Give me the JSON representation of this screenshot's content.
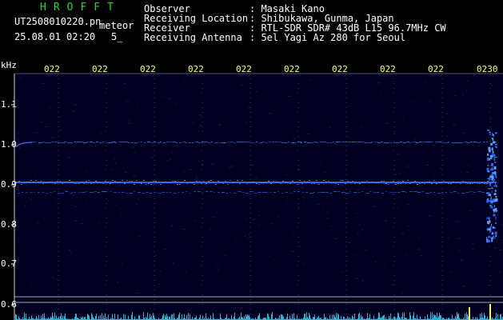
{
  "brand": "HROFFT",
  "file_info": {
    "filename": "UT2508010220.pn",
    "mode": "meteor",
    "datetime": "25.08.01 02:20",
    "count": "5_"
  },
  "station": {
    "rows": [
      {
        "label": "Observer",
        "value": ": Masaki Kano"
      },
      {
        "label": "Receiving Location",
        "value": ": Shibukawa, Gunma, Japan"
      },
      {
        "label": "Receiver",
        "value": ": RTL-SDR SDR# 43dB L15 96.7MHz CW"
      },
      {
        "label": "Receiving Antenna",
        "value": ": 5el Yagi Az 280 for Seoul"
      }
    ]
  },
  "spectrogram": {
    "y_unit": "kHz",
    "y_ticks": [
      "1.1",
      "1.0",
      "0.9",
      "0.8",
      "0.7",
      "0.6"
    ],
    "x_ticks": [
      "022",
      "022",
      "022",
      "022",
      "022",
      "022",
      "022",
      "022",
      "022",
      "0230"
    ],
    "colors": {
      "background": "#000020",
      "grid": "#3a3a8a",
      "signal": "#3a78ff",
      "noise": "#40e0ff"
    }
  }
}
